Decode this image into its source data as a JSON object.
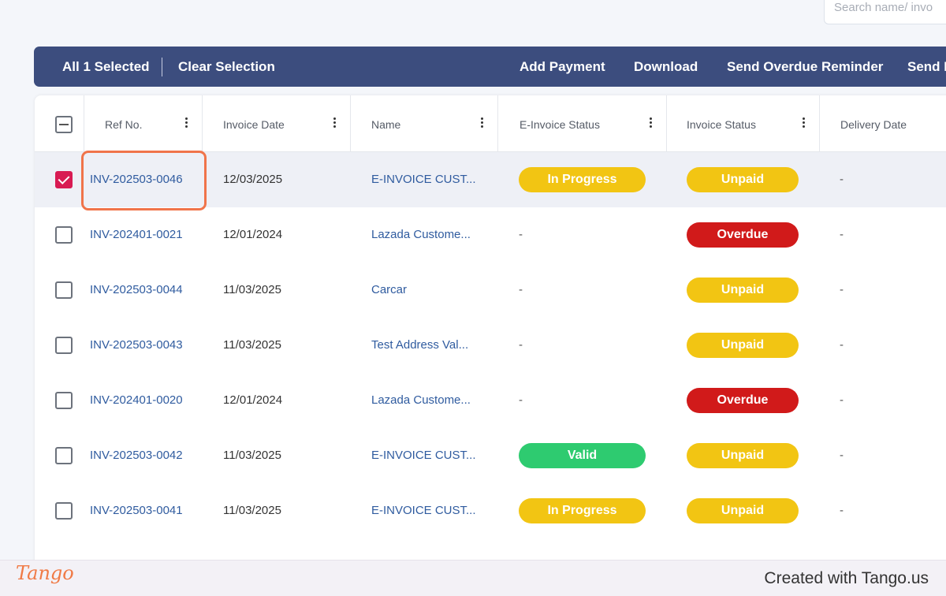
{
  "search": {
    "placeholder": "Search name/ invo"
  },
  "selection_bar": {
    "selected_label": "All 1 Selected",
    "clear_label": "Clear Selection",
    "actions": [
      "Add Payment",
      "Download",
      "Send Overdue Reminder",
      "Send I"
    ]
  },
  "table": {
    "columns": [
      "Ref No.",
      "Invoice Date",
      "Name",
      "E-Invoice Status",
      "Invoice Status",
      "Delivery Date"
    ],
    "rows": [
      {
        "ref": "INV-202503-0046",
        "date": "12/03/2025",
        "name": "E-INVOICE CUST...",
        "einvoice": "In Progress",
        "status": "Unpaid",
        "delivery": "-",
        "checked": true
      },
      {
        "ref": "INV-202401-0021",
        "date": "12/01/2024",
        "name": "Lazada Custome...",
        "einvoice": "-",
        "status": "Overdue",
        "delivery": "-",
        "checked": false
      },
      {
        "ref": "INV-202503-0044",
        "date": "11/03/2025",
        "name": "Carcar",
        "einvoice": "-",
        "status": "Unpaid",
        "delivery": "-",
        "checked": false
      },
      {
        "ref": "INV-202503-0043",
        "date": "11/03/2025",
        "name": "Test Address Val...",
        "einvoice": "-",
        "status": "Unpaid",
        "delivery": "-",
        "checked": false
      },
      {
        "ref": "INV-202401-0020",
        "date": "12/01/2024",
        "name": "Lazada Custome...",
        "einvoice": "-",
        "status": "Overdue",
        "delivery": "-",
        "checked": false
      },
      {
        "ref": "INV-202503-0042",
        "date": "11/03/2025",
        "name": "E-INVOICE CUST...",
        "einvoice": "Valid",
        "status": "Unpaid",
        "delivery": "-",
        "checked": false
      },
      {
        "ref": "INV-202503-0041",
        "date": "11/03/2025",
        "name": "E-INVOICE CUST...",
        "einvoice": "In Progress",
        "status": "Unpaid",
        "delivery": "-",
        "checked": false
      }
    ]
  },
  "colors": {
    "unpaid": "#f2c513",
    "overdue": "#d11a1a",
    "valid": "#2ecb70",
    "in_progress": "#f2c513",
    "header_bar": "#3c4d7e",
    "checkbox_checked": "#d81b53"
  },
  "footer": {
    "logo": "Tango",
    "credit": "Created with Tango.us"
  }
}
